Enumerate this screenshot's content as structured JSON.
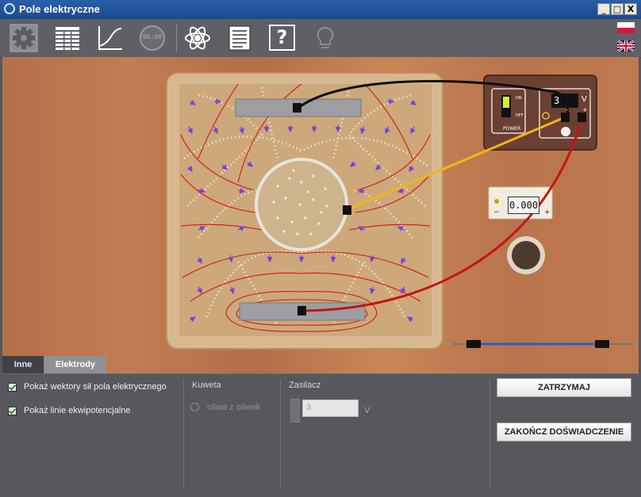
{
  "window": {
    "title": "Pole elektryczne",
    "minimize_glyph": "_",
    "maximize_glyph": "□",
    "close_glyph": "X"
  },
  "toolbar": {
    "buttons": [
      "gear-icon",
      "table-icon",
      "graph-icon",
      "timer-icon",
      "atom-icon",
      "document-icon",
      "help-icon",
      "lightbulb-icon"
    ],
    "timer_text": "00:00",
    "help_glyph": "?",
    "languages": [
      "polish-flag",
      "english-flag"
    ]
  },
  "apparatus": {
    "power_supply": {
      "display": "3",
      "unit": "V",
      "switch_on": "ON",
      "switch_off": "OFF",
      "power_label": "POWER",
      "minus": "-",
      "plus": "+"
    },
    "meter": {
      "display": "0.000",
      "minus": "−",
      "plus": "+"
    },
    "wire_colors": {
      "black": "#0d0d0d",
      "yellow": "#f2b51a",
      "red": "#c81212",
      "blue": "#2f58c8"
    }
  },
  "tabs": [
    {
      "label": "Inne",
      "active": true
    },
    {
      "label": "Elektrody",
      "active": false
    }
  ],
  "panel": {
    "checkboxes": [
      {
        "label": "Pokaż wektory sił pola elektrycznego",
        "checked": true
      },
      {
        "label": "Pokaż linie ekwipotencjalne",
        "checked": true
      }
    ],
    "kuweta": {
      "title": "Kuweta",
      "option": "oliwa z oliwek"
    },
    "zasilacz": {
      "title": "Zasilacz",
      "value": "3",
      "unit": "V"
    },
    "buttons": {
      "stop": "ZATRZYMAJ",
      "finish": "ZAKOŃCZ DOŚWIADCZENIE"
    }
  },
  "colors": {
    "titlebar": "#1f4f94",
    "toolbar": "#5e6065",
    "panel": "#56585d",
    "field_line": "#d01818",
    "vector": "#7a3fe0"
  }
}
